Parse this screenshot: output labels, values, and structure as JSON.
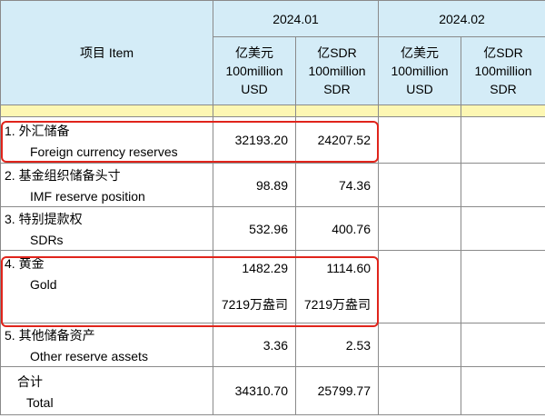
{
  "header": {
    "item_label": "项目  Item",
    "periods": [
      "2024.01",
      "2024.02"
    ],
    "columns": [
      {
        "line1": "亿美元",
        "line2": "100million",
        "line3": "USD"
      },
      {
        "line1": "亿SDR",
        "line2": "100million",
        "line3": "SDR"
      },
      {
        "line1": "亿美元",
        "line2": "100million",
        "line3": "USD"
      },
      {
        "line1": "亿SDR",
        "line2": "100million",
        "line3": "SDR"
      }
    ]
  },
  "rows": [
    {
      "cn": "1.  外汇储备",
      "en": "Foreign currency reserves",
      "usd": "32193.20",
      "sdr": "24207.52"
    },
    {
      "cn": "2.  基金组织储备头寸",
      "en": "IMF reserve position",
      "usd": "98.89",
      "sdr": "74.36"
    },
    {
      "cn": "3.  特别提款权",
      "en": "SDRs",
      "usd": "532.96",
      "sdr": "400.76"
    },
    {
      "cn": "4.  黄金",
      "en": "Gold",
      "usd": "1482.29",
      "sdr": "1114.60",
      "usd_extra": "7219万盎司",
      "sdr_extra": "7219万盎司"
    },
    {
      "cn": "5.  其他储备资产",
      "en": "Other reserve assets",
      "usd": "3.36",
      "sdr": "2.53"
    },
    {
      "cn": "合计",
      "en": "Total",
      "usd": "34310.70",
      "sdr": "25799.77"
    }
  ],
  "colors": {
    "header_bg": "#d4ecf7",
    "stripe_bg": "#fdf7b3",
    "highlight": "#e0241b"
  }
}
